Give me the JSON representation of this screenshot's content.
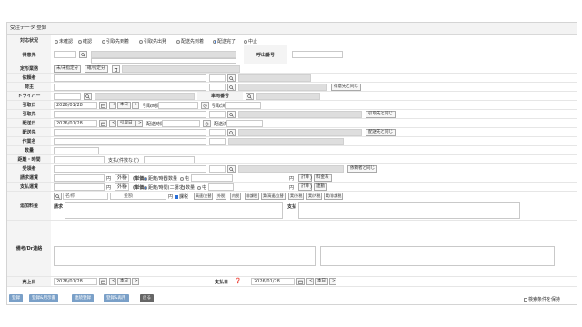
{
  "title": "受注データ 登録",
  "labels": {
    "status": "対応状況",
    "customer": "得意先",
    "call_no": "呼出番号",
    "fixed_task": "定形業務",
    "requester": "依頼者",
    "shipper": "荷主",
    "driver": "ドライバー",
    "vehicle_no": "車両番号",
    "pickup_date": "引取日",
    "pickup_place": "引取先",
    "delivery_date": "配送日",
    "delivery_place": "配送先",
    "work_name": "作業名",
    "quantity": "数量",
    "distance_time": "距離・時間",
    "receiver": "受領者",
    "billing_fare": "請求運賃",
    "payment_fare": "支払運賃",
    "extra_fee": "追加料金",
    "memo": "備考/Dr連絡",
    "sales_date": "売上日",
    "payment_date": "支払日"
  },
  "status_options": [
    {
      "label": "未確認",
      "selected": false
    },
    {
      "label": "確認",
      "selected": false
    },
    {
      "label": "引取先到着",
      "selected": false
    },
    {
      "label": "引取先出発",
      "selected": false
    },
    {
      "label": "配送先到着",
      "selected": false
    },
    {
      "label": "配送完了",
      "selected": true
    },
    {
      "label": "中止",
      "selected": false
    }
  ],
  "buttons": {
    "unassigned": "未/未指定分",
    "assigned": "確/指定分",
    "same_as_customer": "得意先と同じ",
    "same_as_pickup": "引取先と同じ",
    "same_as_delivery": "配送先と同じ",
    "same_as_requester": "依頼者と同じ",
    "today": "本日",
    "pickup_day": "引取日",
    "calc": "計算",
    "fare_table": "料金表",
    "link": "連動"
  },
  "fields": {
    "pickup_date_value": "2026/01/28",
    "pickup_time_label": "引取時間",
    "pickup_done": "引取済",
    "delivery_date_value": "2026/01/28",
    "delivery_time_label": "配送時間",
    "delivery_done": "配送済",
    "pay_count_label": "支払(件数など)",
    "yen": "円",
    "tax_excluded": "外税",
    "unit_label": "(単価",
    "distance_time_opt": "距離/時間",
    "quantity_opt": "数量",
    "ton_opt": "屯",
    "close_paren": ")",
    "billing_sync": "距離/時間(二請求)",
    "extra_name": "名称",
    "extra_amount": "金額",
    "extra_tax": "課税",
    "billing_sub": "請求",
    "payment_sub": "支払",
    "sales_date_value": "2026/01/28",
    "payment_date_value": "2026/01/28"
  },
  "extra_fee_buttons": [
    "高速/立替",
    "外税",
    "内税",
    "非課税",
    "実/高速/立替",
    "実/外税",
    "実/内税",
    "実/非課税"
  ],
  "footer": {
    "register": "登録",
    "register_print": "登録&用示書",
    "continuous": "連続登録",
    "register_copy": "登録&再用",
    "back": "戻る",
    "keep_search": "検索条件を保持"
  }
}
